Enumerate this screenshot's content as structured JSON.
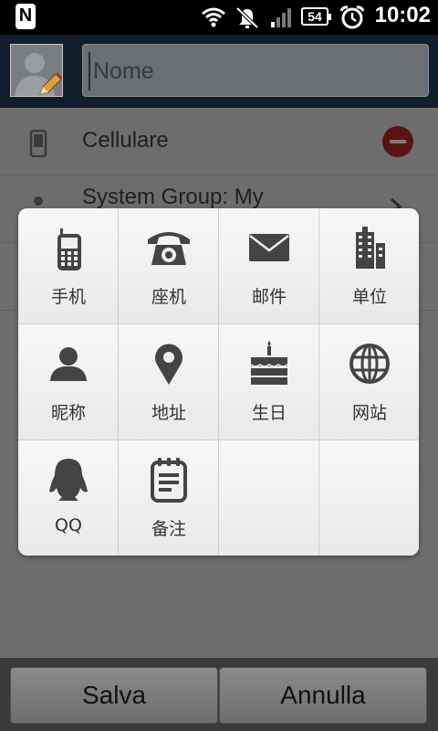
{
  "status_bar": {
    "app_icon_letter": "N",
    "icons": [
      "wifi-icon",
      "mute-icon",
      "signal-icon",
      "battery-icon",
      "alarm-icon"
    ],
    "battery": "54",
    "time": "10:02"
  },
  "header": {
    "name_placeholder": "Nome",
    "name_value": ""
  },
  "form": {
    "phone_label": "Cellulare",
    "group_label": "System Group: My"
  },
  "popup": {
    "items": [
      {
        "label": "手机",
        "icon": "mobile-phone-icon"
      },
      {
        "label": "座机",
        "icon": "landline-phone-icon"
      },
      {
        "label": "邮件",
        "icon": "mail-icon"
      },
      {
        "label": "单位",
        "icon": "building-icon"
      },
      {
        "label": "昵称",
        "icon": "person-icon"
      },
      {
        "label": "地址",
        "icon": "map-pin-icon"
      },
      {
        "label": "生日",
        "icon": "birthday-cake-icon"
      },
      {
        "label": "网站",
        "icon": "globe-icon"
      },
      {
        "label": "QQ",
        "icon": "qq-penguin-icon"
      },
      {
        "label": "备注",
        "icon": "notepad-icon"
      }
    ]
  },
  "bottom_bar": {
    "save_label": "Salva",
    "cancel_label": "Annulla"
  },
  "colors": {
    "status_bar": "#000000",
    "header_bg": "#121e2c",
    "popup_bg": "#f1f1f1",
    "icon_color": "#444444",
    "remove_red": "#5b1212"
  }
}
